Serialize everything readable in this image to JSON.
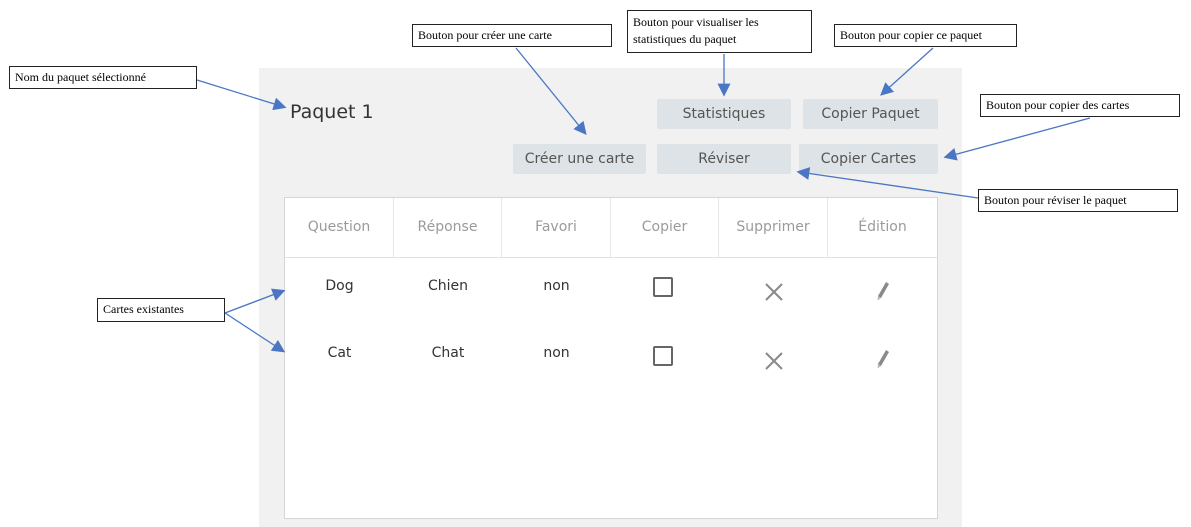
{
  "deck": {
    "title": "Paquet 1"
  },
  "buttons": {
    "stats": "Statistiques",
    "copy_deck": "Copier Paquet",
    "create_card": "Créer une carte",
    "review": "Réviser",
    "copy_cards": "Copier Cartes"
  },
  "table": {
    "headers": [
      "Question",
      "Réponse",
      "Favori",
      "Copier",
      "Supprimer",
      "Édition"
    ],
    "rows": [
      {
        "question": "Dog",
        "answer": "Chien",
        "favorite": "non"
      },
      {
        "question": "Cat",
        "answer": "Chat",
        "favorite": "non"
      }
    ]
  },
  "annotations": {
    "deck_name": "Nom du paquet sélectionné",
    "create_card": "Bouton pour créer une carte",
    "stats": "Bouton pour visualiser les statistiques du paquet",
    "copy_deck": "Bouton pour copier ce paquet",
    "copy_cards": "Bouton pour copier des cartes",
    "review": "Bouton pour réviser le paquet",
    "existing_cards": "Cartes existantes"
  },
  "colors": {
    "button_bg": "#dde3e6",
    "panel_bg": "#f1f1f1",
    "arrow": "#4a76c4"
  },
  "icons": [
    "checkbox-icon",
    "close-icon",
    "pencil-icon"
  ]
}
